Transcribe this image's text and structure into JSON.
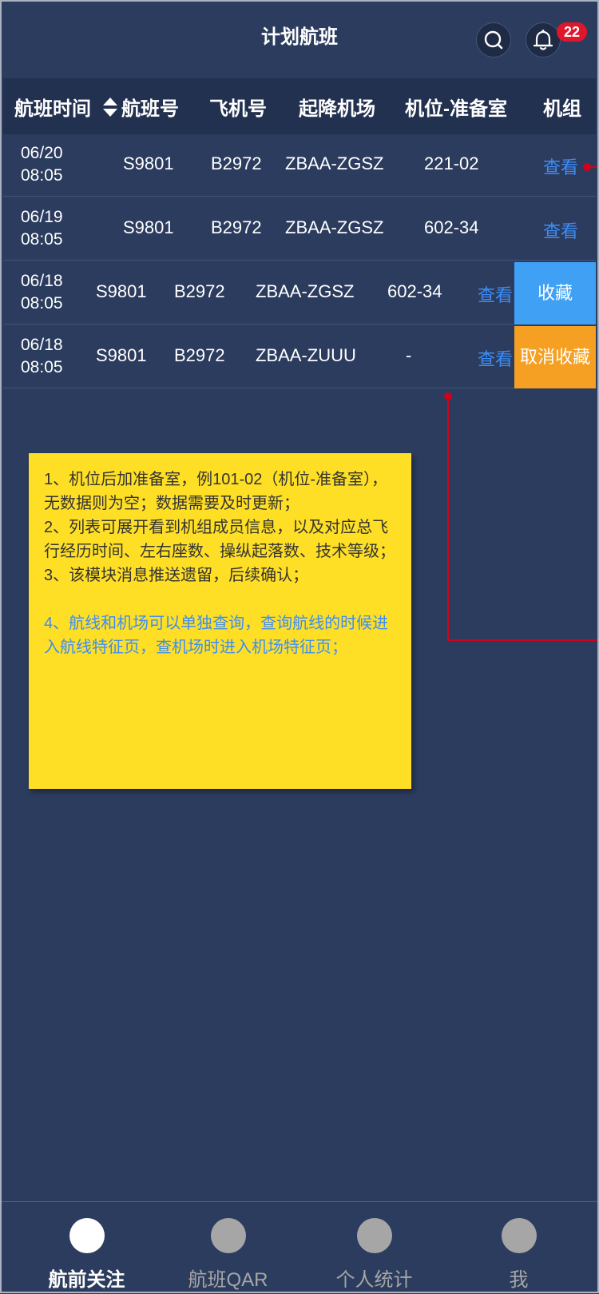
{
  "header": {
    "title": "计划航班",
    "notification_count": "22"
  },
  "table": {
    "columns": [
      "航班时间",
      "航班号",
      "飞机号",
      "起降机场",
      "机位-准备室",
      "机组"
    ],
    "rows": [
      {
        "date": "06/20",
        "time": "08:05",
        "flight_no": "S9801",
        "aircraft": "B2972",
        "route": "ZBAA-ZGSZ",
        "stand_room": "221-02",
        "crew_link": "查看"
      },
      {
        "date": "06/19",
        "time": "08:05",
        "flight_no": "S9801",
        "aircraft": "B2972",
        "route": "ZBAA-ZGSZ",
        "stand_room": "602-34",
        "crew_link": "查看"
      },
      {
        "date": "06/18",
        "time": "08:05",
        "flight_no": "S9801",
        "aircraft": "B2972",
        "route": "ZBAA-ZGSZ",
        "stand_room": "602-34",
        "crew_link": "查看",
        "swipe_action": "收藏"
      },
      {
        "date": "06/18",
        "time": "08:05",
        "flight_no": "S9801",
        "aircraft": "B2972",
        "route": "ZBAA-ZUUU",
        "stand_room": "-",
        "crew_link": "查看",
        "swipe_action": "取消收藏"
      }
    ]
  },
  "note": {
    "line1": "1、机位后加准备室，例101-02（机位-准备室），无数据则为空；数据需要及时更新；",
    "line2": "2、列表可展开看到机组成员信息，以及对应总飞行经历时间、左右座数、操纵起落数、技术等级；",
    "line3": "3、该模块消息推送遗留，后续确认；",
    "line4": "4、航线和机场可以单独查询，查询航线的时候进入航线特征页，查机场时进入机场特征页；"
  },
  "tabbar": {
    "items": [
      {
        "label": "航前关注",
        "active": true
      },
      {
        "label": "航班QAR",
        "active": false
      },
      {
        "label": "个人统计",
        "active": false
      },
      {
        "label": "我",
        "active": false
      }
    ]
  },
  "colors": {
    "background": "#2c3c5e",
    "header_row": "#233150",
    "link": "#3d8df5",
    "favorite": "#3fa0f4",
    "unfavorite": "#f5a023",
    "note": "#fedf26",
    "badge": "#e0162b",
    "connector": "#d0021b"
  },
  "icons": [
    "search-icon",
    "bell-icon",
    "sort-icon"
  ]
}
